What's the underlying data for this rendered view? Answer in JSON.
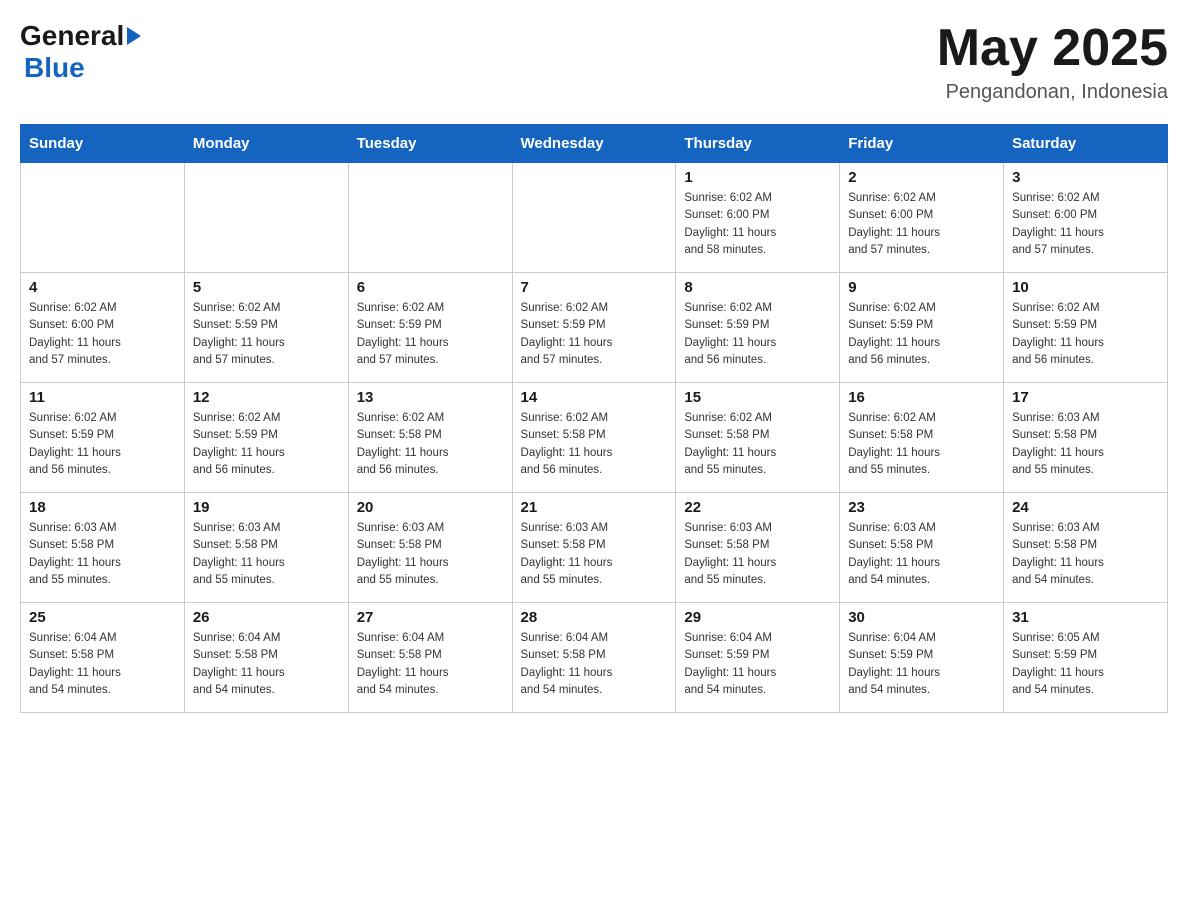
{
  "header": {
    "logo_general": "General",
    "logo_blue": "Blue",
    "month_year": "May 2025",
    "location": "Pengandonan, Indonesia"
  },
  "days_of_week": [
    "Sunday",
    "Monday",
    "Tuesday",
    "Wednesday",
    "Thursday",
    "Friday",
    "Saturday"
  ],
  "weeks": [
    [
      {
        "day": "",
        "info": ""
      },
      {
        "day": "",
        "info": ""
      },
      {
        "day": "",
        "info": ""
      },
      {
        "day": "",
        "info": ""
      },
      {
        "day": "1",
        "info": "Sunrise: 6:02 AM\nSunset: 6:00 PM\nDaylight: 11 hours\nand 58 minutes."
      },
      {
        "day": "2",
        "info": "Sunrise: 6:02 AM\nSunset: 6:00 PM\nDaylight: 11 hours\nand 57 minutes."
      },
      {
        "day": "3",
        "info": "Sunrise: 6:02 AM\nSunset: 6:00 PM\nDaylight: 11 hours\nand 57 minutes."
      }
    ],
    [
      {
        "day": "4",
        "info": "Sunrise: 6:02 AM\nSunset: 6:00 PM\nDaylight: 11 hours\nand 57 minutes."
      },
      {
        "day": "5",
        "info": "Sunrise: 6:02 AM\nSunset: 5:59 PM\nDaylight: 11 hours\nand 57 minutes."
      },
      {
        "day": "6",
        "info": "Sunrise: 6:02 AM\nSunset: 5:59 PM\nDaylight: 11 hours\nand 57 minutes."
      },
      {
        "day": "7",
        "info": "Sunrise: 6:02 AM\nSunset: 5:59 PM\nDaylight: 11 hours\nand 57 minutes."
      },
      {
        "day": "8",
        "info": "Sunrise: 6:02 AM\nSunset: 5:59 PM\nDaylight: 11 hours\nand 56 minutes."
      },
      {
        "day": "9",
        "info": "Sunrise: 6:02 AM\nSunset: 5:59 PM\nDaylight: 11 hours\nand 56 minutes."
      },
      {
        "day": "10",
        "info": "Sunrise: 6:02 AM\nSunset: 5:59 PM\nDaylight: 11 hours\nand 56 minutes."
      }
    ],
    [
      {
        "day": "11",
        "info": "Sunrise: 6:02 AM\nSunset: 5:59 PM\nDaylight: 11 hours\nand 56 minutes."
      },
      {
        "day": "12",
        "info": "Sunrise: 6:02 AM\nSunset: 5:59 PM\nDaylight: 11 hours\nand 56 minutes."
      },
      {
        "day": "13",
        "info": "Sunrise: 6:02 AM\nSunset: 5:58 PM\nDaylight: 11 hours\nand 56 minutes."
      },
      {
        "day": "14",
        "info": "Sunrise: 6:02 AM\nSunset: 5:58 PM\nDaylight: 11 hours\nand 56 minutes."
      },
      {
        "day": "15",
        "info": "Sunrise: 6:02 AM\nSunset: 5:58 PM\nDaylight: 11 hours\nand 55 minutes."
      },
      {
        "day": "16",
        "info": "Sunrise: 6:02 AM\nSunset: 5:58 PM\nDaylight: 11 hours\nand 55 minutes."
      },
      {
        "day": "17",
        "info": "Sunrise: 6:03 AM\nSunset: 5:58 PM\nDaylight: 11 hours\nand 55 minutes."
      }
    ],
    [
      {
        "day": "18",
        "info": "Sunrise: 6:03 AM\nSunset: 5:58 PM\nDaylight: 11 hours\nand 55 minutes."
      },
      {
        "day": "19",
        "info": "Sunrise: 6:03 AM\nSunset: 5:58 PM\nDaylight: 11 hours\nand 55 minutes."
      },
      {
        "day": "20",
        "info": "Sunrise: 6:03 AM\nSunset: 5:58 PM\nDaylight: 11 hours\nand 55 minutes."
      },
      {
        "day": "21",
        "info": "Sunrise: 6:03 AM\nSunset: 5:58 PM\nDaylight: 11 hours\nand 55 minutes."
      },
      {
        "day": "22",
        "info": "Sunrise: 6:03 AM\nSunset: 5:58 PM\nDaylight: 11 hours\nand 55 minutes."
      },
      {
        "day": "23",
        "info": "Sunrise: 6:03 AM\nSunset: 5:58 PM\nDaylight: 11 hours\nand 54 minutes."
      },
      {
        "day": "24",
        "info": "Sunrise: 6:03 AM\nSunset: 5:58 PM\nDaylight: 11 hours\nand 54 minutes."
      }
    ],
    [
      {
        "day": "25",
        "info": "Sunrise: 6:04 AM\nSunset: 5:58 PM\nDaylight: 11 hours\nand 54 minutes."
      },
      {
        "day": "26",
        "info": "Sunrise: 6:04 AM\nSunset: 5:58 PM\nDaylight: 11 hours\nand 54 minutes."
      },
      {
        "day": "27",
        "info": "Sunrise: 6:04 AM\nSunset: 5:58 PM\nDaylight: 11 hours\nand 54 minutes."
      },
      {
        "day": "28",
        "info": "Sunrise: 6:04 AM\nSunset: 5:58 PM\nDaylight: 11 hours\nand 54 minutes."
      },
      {
        "day": "29",
        "info": "Sunrise: 6:04 AM\nSunset: 5:59 PM\nDaylight: 11 hours\nand 54 minutes."
      },
      {
        "day": "30",
        "info": "Sunrise: 6:04 AM\nSunset: 5:59 PM\nDaylight: 11 hours\nand 54 minutes."
      },
      {
        "day": "31",
        "info": "Sunrise: 6:05 AM\nSunset: 5:59 PM\nDaylight: 11 hours\nand 54 minutes."
      }
    ]
  ]
}
